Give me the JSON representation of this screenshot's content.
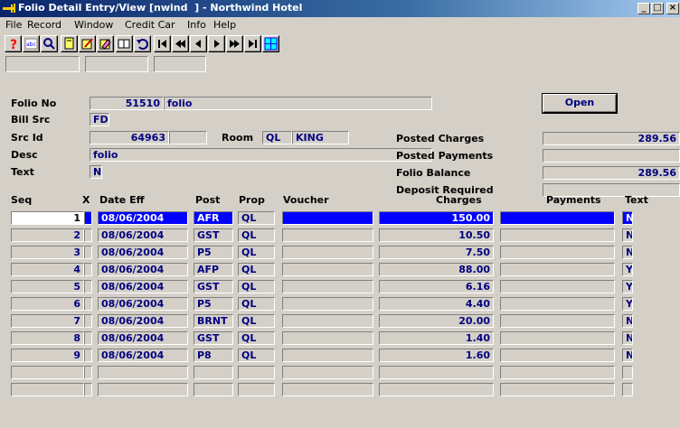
{
  "window": {
    "title": "Folio Detail Entry/View [nwind  ] - Northwind Hotel",
    "min_label": "_",
    "max_label": "□",
    "close_label": "×"
  },
  "menu": [
    "File",
    "Record",
    "Window",
    "Credit Car",
    "Info",
    "Help"
  ],
  "toolbar_icons": [
    "help-icon",
    "spellcheck-icon",
    "search-icon",
    "note-icon",
    "edit-icon",
    "eraser-icon",
    "book-icon",
    "undo-icon",
    "first-record-icon",
    "previous-page-icon",
    "previous-record-icon",
    "next-record-icon",
    "next-page-icon",
    "last-record-icon",
    "grid-icon"
  ],
  "header": {
    "folio_no_label": "Folio No",
    "folio_no": "51510",
    "folio_desc": "folio",
    "bill_src_label": "Bill Src",
    "bill_src": "FD",
    "src_id_label": "Src Id",
    "src_id": "64963",
    "room_label": "Room",
    "room_prop": "QL",
    "room_type": "KING",
    "desc_label": "Desc",
    "desc": "folio",
    "text_label": "Text",
    "text": "N",
    "open_button": "Open"
  },
  "summary": {
    "posted_charges_label": "Posted Charges",
    "posted_charges": "289.56",
    "posted_payments_label": "Posted Payments",
    "posted_payments": "",
    "folio_balance_label": "Folio Balance",
    "folio_balance": "289.56",
    "deposit_required_label": "Deposit Required",
    "deposit_required": ""
  },
  "table": {
    "headers": {
      "seq": "Seq",
      "x": "X",
      "date_eff": "Date Eff",
      "post": "Post",
      "prop": "Prop",
      "voucher": "Voucher",
      "charges": "Charges",
      "payments": "Payments",
      "text": "Text"
    },
    "rows": [
      {
        "seq": "1",
        "x": "",
        "date": "08/06/2004",
        "post": "AFR",
        "prop": "QL",
        "voucher": "",
        "charges": "150.00",
        "payments": "",
        "text": "N"
      },
      {
        "seq": "2",
        "x": "",
        "date": "08/06/2004",
        "post": "GST",
        "prop": "QL",
        "voucher": "",
        "charges": "10.50",
        "payments": "",
        "text": "N"
      },
      {
        "seq": "3",
        "x": "",
        "date": "08/06/2004",
        "post": "P5",
        "prop": "QL",
        "voucher": "",
        "charges": "7.50",
        "payments": "",
        "text": "N"
      },
      {
        "seq": "4",
        "x": "",
        "date": "08/06/2004",
        "post": "AFP",
        "prop": "QL",
        "voucher": "",
        "charges": "88.00",
        "payments": "",
        "text": "Y"
      },
      {
        "seq": "5",
        "x": "",
        "date": "08/06/2004",
        "post": "GST",
        "prop": "QL",
        "voucher": "",
        "charges": "6.16",
        "payments": "",
        "text": "Y"
      },
      {
        "seq": "6",
        "x": "",
        "date": "08/06/2004",
        "post": "P5",
        "prop": "QL",
        "voucher": "",
        "charges": "4.40",
        "payments": "",
        "text": "Y"
      },
      {
        "seq": "7",
        "x": "",
        "date": "08/06/2004",
        "post": "BRNT",
        "prop": "QL",
        "voucher": "",
        "charges": "20.00",
        "payments": "",
        "text": "N"
      },
      {
        "seq": "8",
        "x": "",
        "date": "08/06/2004",
        "post": "GST",
        "prop": "QL",
        "voucher": "",
        "charges": "1.40",
        "payments": "",
        "text": "N"
      },
      {
        "seq": "9",
        "x": "",
        "date": "08/06/2004",
        "post": "P8",
        "prop": "QL",
        "voucher": "",
        "charges": "1.60",
        "payments": "",
        "text": "N"
      },
      {
        "seq": "",
        "x": "",
        "date": "",
        "post": "",
        "prop": "",
        "voucher": "",
        "charges": "",
        "payments": "",
        "text": ""
      },
      {
        "seq": "",
        "x": "",
        "date": "",
        "post": "",
        "prop": "",
        "voucher": "",
        "charges": "",
        "payments": "",
        "text": ""
      }
    ]
  },
  "colors": {
    "title_start": "#0a246a",
    "field_text": "#000080",
    "selection": "#0000ff",
    "window_bg": "#d4d0c8"
  }
}
